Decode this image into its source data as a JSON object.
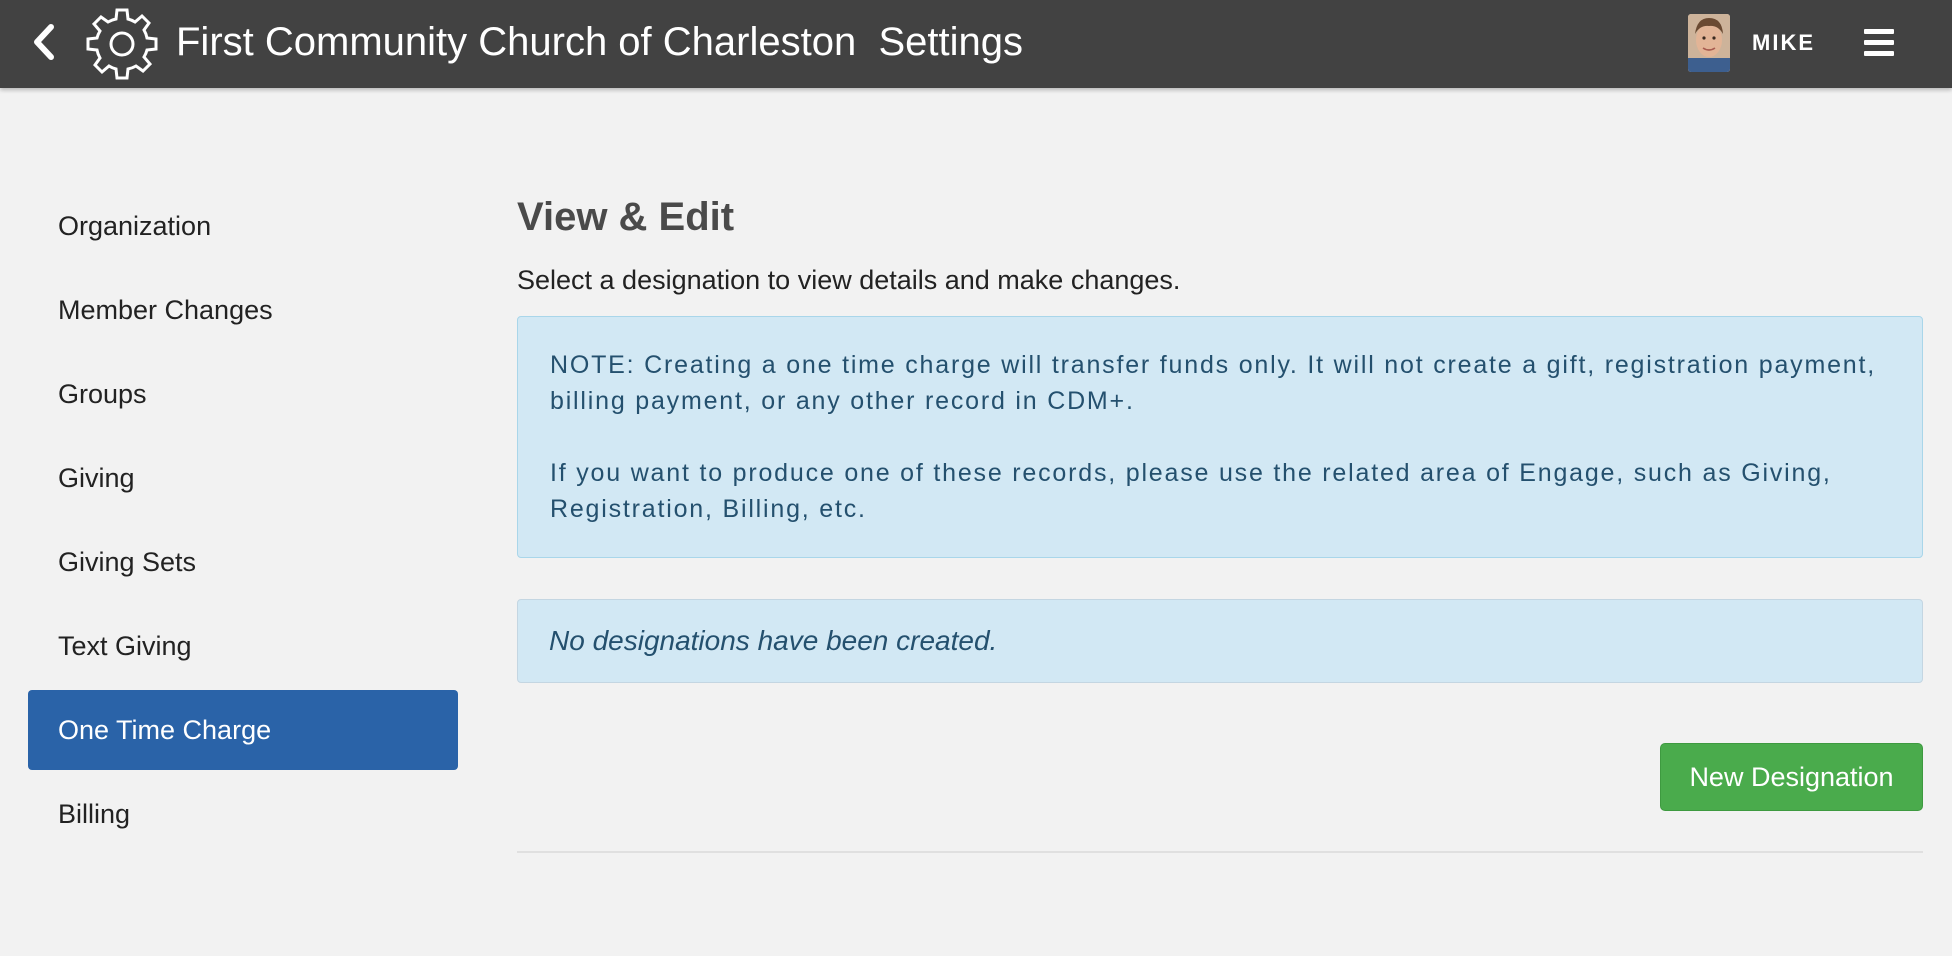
{
  "header": {
    "app_title": "First Community Church of Charleston  Settings",
    "username": "MIKE",
    "icons": {
      "back": "chevron-left-icon",
      "settings": "gear-icon",
      "menu": "hamburger-menu-icon"
    },
    "bar_color": "#424242"
  },
  "sidebar": {
    "items": [
      {
        "label": "Organization",
        "active": false
      },
      {
        "label": "Member Changes",
        "active": false
      },
      {
        "label": "Groups",
        "active": false
      },
      {
        "label": "Giving",
        "active": false
      },
      {
        "label": "Giving Sets",
        "active": false
      },
      {
        "label": "Text Giving",
        "active": false
      },
      {
        "label": "One Time Charge",
        "active": true
      },
      {
        "label": "Billing",
        "active": false
      }
    ],
    "active_color": "#2a63a8"
  },
  "main": {
    "heading": "View & Edit",
    "subtitle": "Select a designation to view details and make changes.",
    "note": {
      "paragraph1": "NOTE: Creating a one time charge will transfer funds only. It will not create a gift, registration payment, billing payment, or any other record in CDM+.",
      "paragraph2": "If you want to produce one of these records, please use the related area of Engage, such as Giving, Registration, Billing, etc."
    },
    "empty_message": "No designations have been created.",
    "new_button_label": "New Designation",
    "new_button_color": "#4aab4c"
  }
}
